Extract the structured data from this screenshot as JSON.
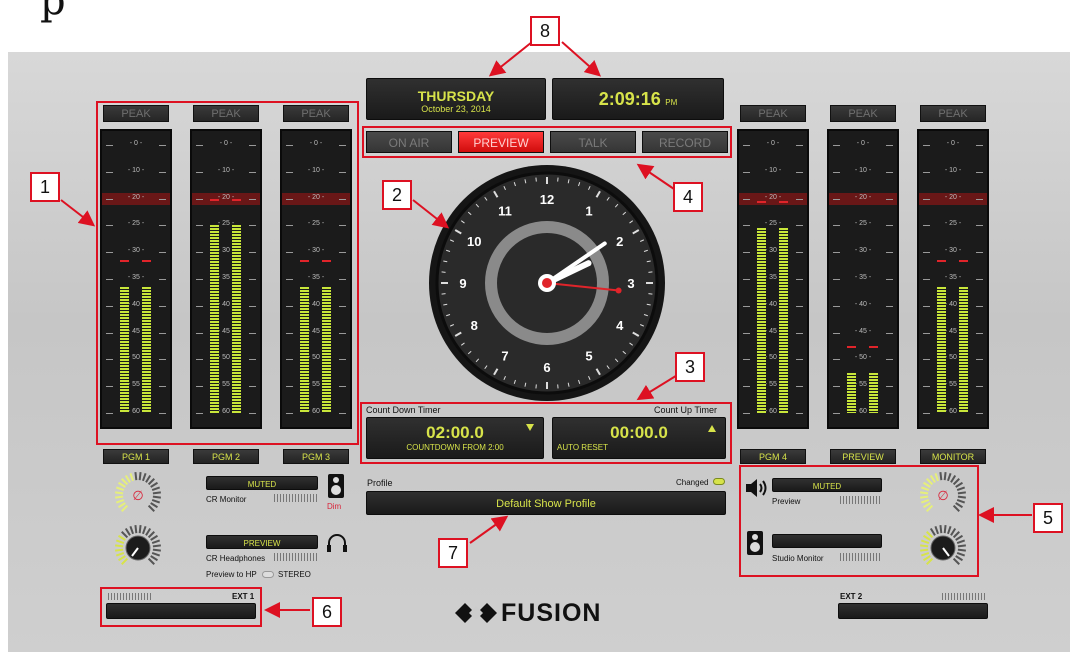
{
  "header": {
    "day": "THURSDAY",
    "date": "October 23, 2014",
    "time": "2:09:16",
    "ampm": "PM"
  },
  "status_buttons": [
    {
      "label": "ON AIR",
      "active": false
    },
    {
      "label": "PREVIEW",
      "active": true
    },
    {
      "label": "TALK",
      "active": false
    },
    {
      "label": "RECORD",
      "active": false
    }
  ],
  "meter_scale": [
    "- 0 -",
    "- 10 -",
    "- 20 -",
    "- 25 -",
    "- 30 -",
    "- 35 -",
    "- 40 -",
    "- 45 -",
    "- 50 -",
    "- 55 -",
    "- 60 -"
  ],
  "meters_left": [
    {
      "peak": "PEAK",
      "label": "PGM 1",
      "level": 0.47
    },
    {
      "peak": "PEAK",
      "label": "PGM 2",
      "level": 0.7
    },
    {
      "peak": "PEAK",
      "label": "PGM 3",
      "level": 0.47
    }
  ],
  "meters_right": [
    {
      "peak": "PEAK",
      "label": "PGM 4",
      "level": 0.69
    },
    {
      "peak": "PEAK",
      "label": "PREVIEW",
      "level": 0.15
    },
    {
      "peak": "PEAK",
      "label": "MONITOR",
      "level": 0.47
    }
  ],
  "clock": {
    "numerals": [
      "12",
      "1",
      "2",
      "3",
      "4",
      "5",
      "6",
      "7",
      "8",
      "9",
      "10",
      "11"
    ],
    "hour": 2,
    "minute": 9,
    "second": 16
  },
  "timers": {
    "countdown_title": "Count Down Timer",
    "countup_title": "Count Up Timer",
    "countdown_value": "02:00.0",
    "countdown_sub": "COUNTDOWN FROM 2:00",
    "countup_value": "00:00.0",
    "countup_sub": "AUTO RESET"
  },
  "profile": {
    "label": "Profile",
    "changed_label": "Changed",
    "name": "Default Show Profile"
  },
  "left_controls": {
    "muted_label": "MUTED",
    "cr_monitor": "CR Monitor",
    "dim": "Dim",
    "preview_label": "PREVIEW",
    "cr_headphones": "CR Headphones",
    "preview_to_hp": "Preview to HP",
    "stereo": "STEREO"
  },
  "right_controls": {
    "muted_label": "MUTED",
    "preview": "Preview",
    "studio_monitor": "Studio Monitor"
  },
  "ext": {
    "ext1": "EXT 1",
    "ext2": "EXT 2"
  },
  "brand": "FUSION",
  "heading_fragment": "p",
  "callouts": [
    "1",
    "2",
    "3",
    "4",
    "5",
    "6",
    "7",
    "8"
  ],
  "colors": {
    "accent": "#d7e34a",
    "meter": "#c8e63a",
    "alert": "#e0242a",
    "callout": "#dd1122"
  }
}
